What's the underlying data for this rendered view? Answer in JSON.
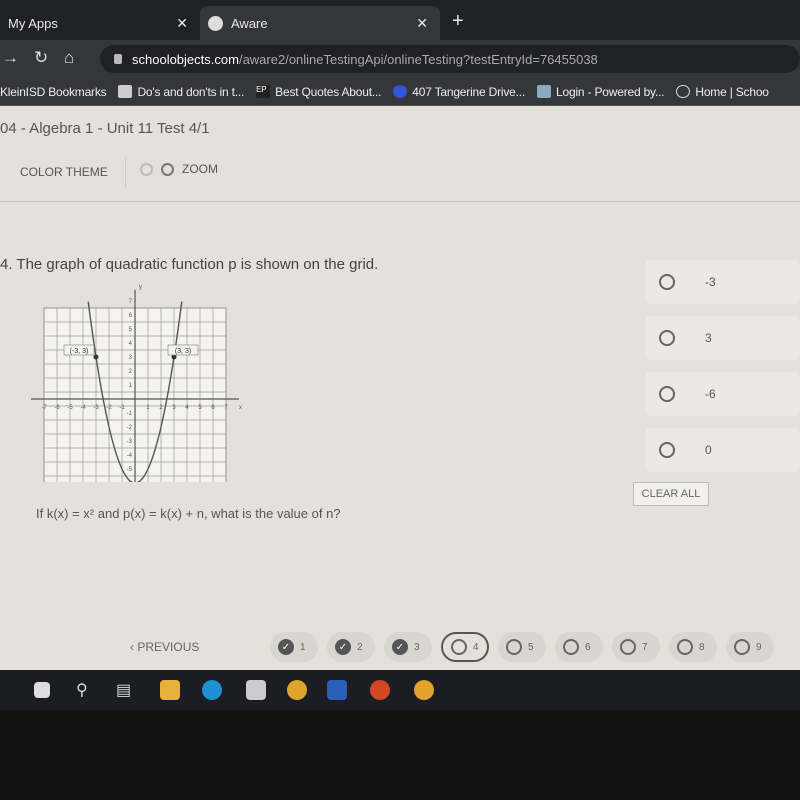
{
  "browser": {
    "tabs": [
      {
        "label": "My Apps"
      },
      {
        "label": "Aware",
        "active": true
      }
    ],
    "url_host": "schoolobjects.com",
    "url_path": "/aware2/onlineTestingApi/onlineTesting?testEntryId=76455038",
    "bookmarks": [
      {
        "label": "KleinISD Bookmarks"
      },
      {
        "label": "Do's and don'ts in t..."
      },
      {
        "label": "Best Quotes About..."
      },
      {
        "label": "407 Tangerine Drive..."
      },
      {
        "label": "Login - Powered by..."
      },
      {
        "label": "Home | Schoo"
      }
    ]
  },
  "test": {
    "title": "04 - Algebra 1 - Unit 11 Test 4/1"
  },
  "toolbar": {
    "color_theme": "COLOR THEME",
    "zoom": "ZOOM"
  },
  "question": {
    "text": "4. The graph of quadratic function p is shown on the grid.",
    "prompt": "If k(x) = x² and p(x) = k(x) + n, what is the value of n?",
    "graph": {
      "function": "p(x) = x^2 - 6",
      "xrange": [
        -7,
        7
      ],
      "yrange": [
        -7,
        7
      ],
      "point_labels": [
        "(-3, 3)",
        "(3, 3)"
      ],
      "x_ticks": [
        -7,
        -6,
        -5,
        -4,
        -3,
        -2,
        -1,
        1,
        2,
        3,
        4,
        5,
        6,
        7
      ],
      "y_ticks": [
        -7,
        -6,
        -5,
        -4,
        -3,
        -2,
        -1,
        1,
        2,
        3,
        4,
        5,
        6,
        7
      ],
      "x_label": "x",
      "y_label": "y"
    }
  },
  "options": [
    {
      "label": "-3"
    },
    {
      "label": "3"
    },
    {
      "label": "-6"
    },
    {
      "label": "0"
    }
  ],
  "clear_all": "CLEAR ALL",
  "nav": {
    "previous": "PREVIOUS",
    "questions": [
      {
        "n": "1",
        "status": "answered"
      },
      {
        "n": "2",
        "status": "answered"
      },
      {
        "n": "3",
        "status": "answered"
      },
      {
        "n": "4",
        "status": "current"
      },
      {
        "n": "5"
      },
      {
        "n": "6"
      },
      {
        "n": "7"
      },
      {
        "n": "8"
      },
      {
        "n": "9"
      }
    ]
  },
  "colors": {
    "page_bg": "#e3e1d9",
    "browser_dark": "#202124"
  }
}
